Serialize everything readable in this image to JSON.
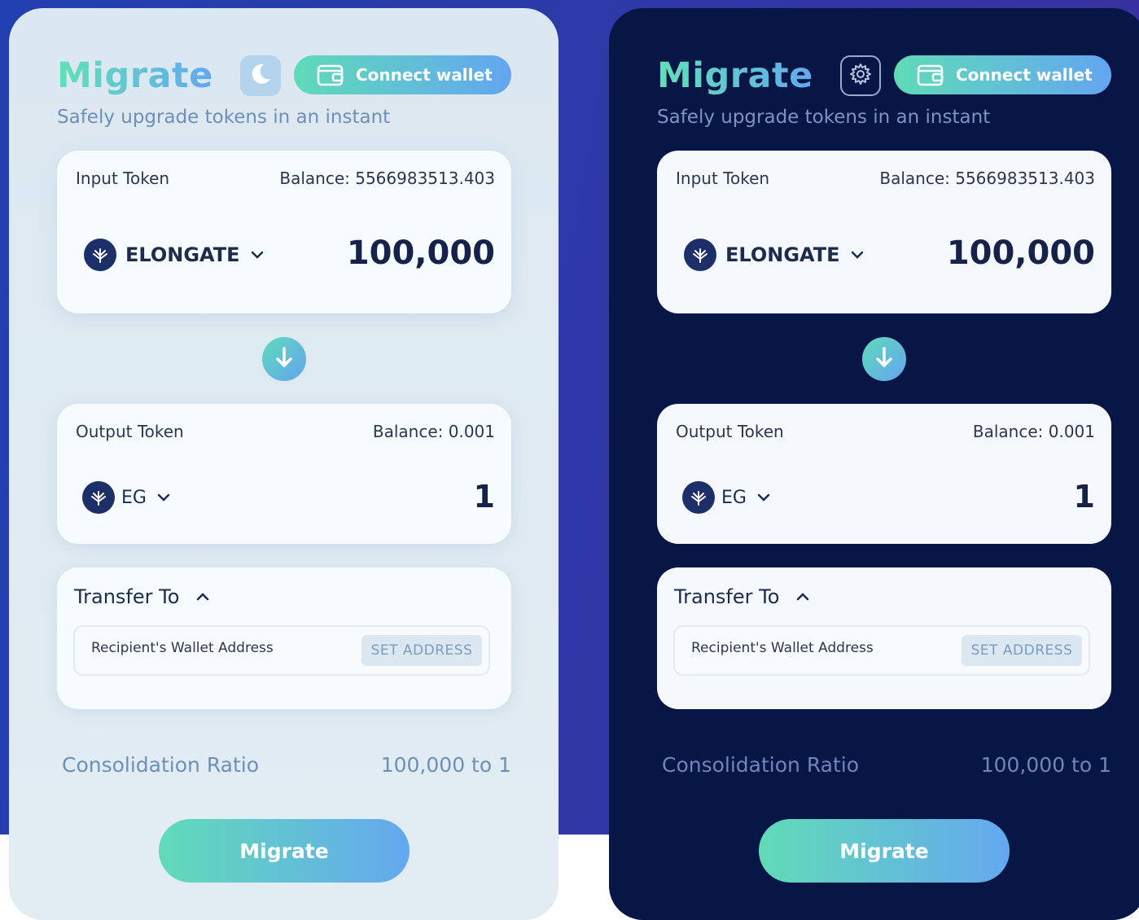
{
  "app": {
    "title": "Migrate",
    "subtitle": "Safely upgrade tokens in an instant",
    "connect_wallet_label": "Connect wallet"
  },
  "input": {
    "label": "Input Token",
    "balance": "Balance: 5566983513.403",
    "token": "ELONGATE",
    "amount": "100,000"
  },
  "output": {
    "label": "Output Token",
    "balance": "Balance: 0.001",
    "token": "EG",
    "amount": "1"
  },
  "transfer": {
    "label": "Transfer To",
    "placeholder": "Recipient's Wallet Address",
    "set_address_label": "SET ADDRESS"
  },
  "ratio": {
    "label": "Consolidation Ratio",
    "value": "100,000 to 1"
  },
  "migrate_button_label": "Migrate",
  "icons": {
    "light_theme_toggle": "moon-icon",
    "dark_theme_toggle": "gear-icon",
    "wallet": "wallet-icon",
    "token": "token-logo-icon",
    "swap_direction": "arrow-down-icon"
  },
  "colors": {
    "accent_start": "#5fdbb8",
    "accent_end": "#63a6f1",
    "dark_panel": "#071645",
    "light_panel": "#dce8f1",
    "background": "#2d3aa8"
  }
}
